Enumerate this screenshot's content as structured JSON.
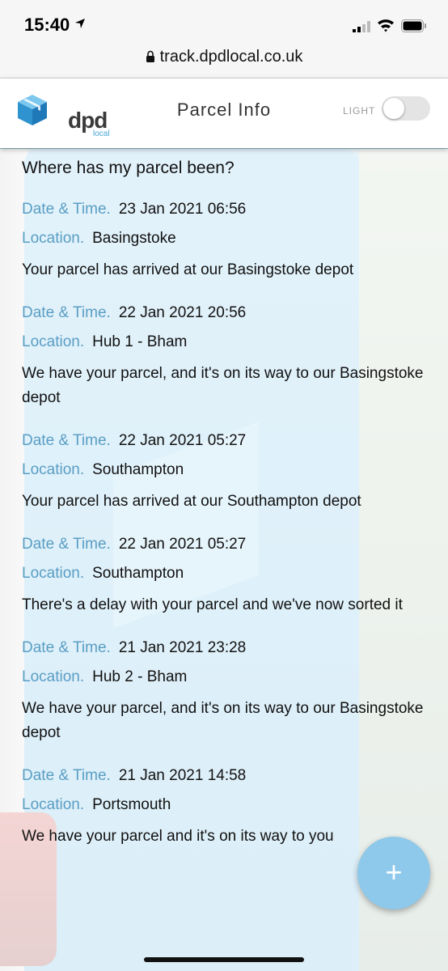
{
  "status_bar": {
    "time": "15:40"
  },
  "browser": {
    "url": "track.dpdlocal.co.uk"
  },
  "header": {
    "logo_text": "dpd",
    "logo_sub": "local",
    "title": "Parcel Info",
    "theme_label": "LIGHT"
  },
  "main": {
    "heading": "Where has my parcel been?",
    "date_label": "Date & Time.",
    "location_label": "Location.",
    "events": [
      {
        "datetime": "23 Jan 2021 06:56",
        "location": "Basingstoke",
        "message": "Your parcel has arrived at our Basingstoke depot"
      },
      {
        "datetime": "22 Jan 2021 20:56",
        "location": "Hub 1 - Bham",
        "message": "We have your parcel, and it's on its way to our Basingstoke depot"
      },
      {
        "datetime": "22 Jan 2021 05:27",
        "location": "Southampton",
        "message": "Your parcel has arrived at our Southampton depot"
      },
      {
        "datetime": "22 Jan 2021 05:27",
        "location": "Southampton",
        "message": "There's a delay with your parcel and we've now sorted it"
      },
      {
        "datetime": "21 Jan 2021 23:28",
        "location": "Hub 2 - Bham",
        "message": "We have your parcel, and it's on its way to our Basingstoke depot"
      },
      {
        "datetime": "21 Jan 2021 14:58",
        "location": "Portsmouth",
        "message": "We have your parcel and it's on its way to you"
      }
    ]
  },
  "fab": {
    "icon": "plus-icon",
    "symbol": "+"
  },
  "colors": {
    "label_blue": "#5a9ec4",
    "fab_blue": "#8ec8ea",
    "dpd_blue": "#4aa6d6"
  }
}
